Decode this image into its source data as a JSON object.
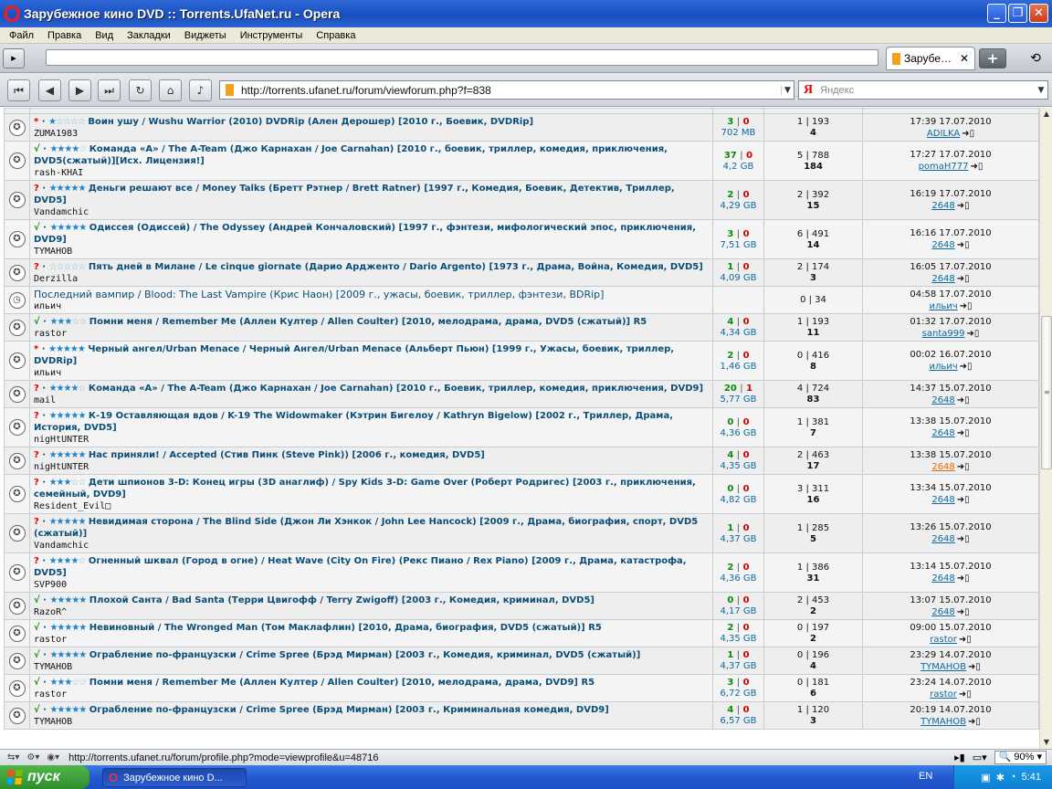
{
  "window": {
    "title": "Зарубежное кино DVD :: Torrents.UfaNet.ru - Opera",
    "controls": [
      "_",
      "❐",
      "✕"
    ]
  },
  "menu": [
    "Файл",
    "Правка",
    "Вид",
    "Закладки",
    "Виджеты",
    "Инструменты",
    "Справка"
  ],
  "tab": {
    "label": "Зарубе…",
    "close": "✕",
    "add": "+"
  },
  "address": {
    "url": "http://torrents.ufanet.ru/forum/viewforum.php?f=838"
  },
  "search": {
    "placeholder": "Яндекс",
    "engine": "Я"
  },
  "colors": {
    "ok_status": "#0a8a0a",
    "question_status": "#dd0000",
    "link": "#0b6aa0"
  },
  "topics": [
    {
      "status": "*",
      "status_type": "star",
      "rating": 1,
      "title": "Воин ушу / Wushu Warrior (2010) DVDRip (Ален Дерошер) [2010 г., Боевик, DVDRip]",
      "author": "ZUMA1983",
      "seeds": "3",
      "leech": "0",
      "size": "702 MB",
      "replies": "1 | 193",
      "downloads": "4",
      "last_time": "17:39 17.07.2010",
      "last_user": "ADILKA"
    },
    {
      "status": "√",
      "status_type": "ok",
      "rating": 4,
      "title": "Команда «А» / The A-Team (Джо Карнахан / Joe Carnahan) [2010 г., боевик, триллер, комедия, приключения, DVD5(сжатый)][Исх. Лицензия!]",
      "author": "rash-KHAI",
      "seeds": "37",
      "leech": "0",
      "size": "4,2 GB",
      "replies": "5 | 788",
      "downloads": "184",
      "last_time": "17:27 17.07.2010",
      "last_user": "pomaH777"
    },
    {
      "status": "?",
      "status_type": "q",
      "rating": 5,
      "title": "Деньги решают все / Money Talks (Бретт Рэтнер / Brett Ratner) [1997 г., Комедия, Боевик, Детектив, Триллер, DVD5]",
      "author": "Vandamchic",
      "seeds": "2",
      "leech": "0",
      "size": "4,29 GB",
      "replies": "2 | 392",
      "downloads": "15",
      "last_time": "16:19 17.07.2010",
      "last_user": "2648"
    },
    {
      "status": "√",
      "status_type": "ok",
      "rating": 5,
      "title": "Одиссея (Одиссей) / The Odyssey (Андрей Кончаловский) [1997 г., фэнтези, мифологический эпос, приключения, DVD9]",
      "author": "TYMAHOB",
      "seeds": "3",
      "leech": "0",
      "size": "7,51 GB",
      "replies": "6 | 491",
      "downloads": "14",
      "last_time": "16:16 17.07.2010",
      "last_user": "2648"
    },
    {
      "status": "?",
      "status_type": "q",
      "rating": 0,
      "title": "Пять дней в Милане / Le cinque giornate (Дарио Ардженто / Dario Argento) [1973 г., Драма, Война, Комедия, DVD5]",
      "author": "Derzilla",
      "seeds": "1",
      "leech": "0",
      "size": "4,09 GB",
      "replies": "2 | 174",
      "downloads": "3",
      "last_time": "16:05 17.07.2010",
      "last_user": "2648"
    },
    {
      "status": "",
      "status_type": "plain",
      "rating": -1,
      "title": "Последний вампир / Blood: The Last Vampire (Крис Наон) [2009 г., ужасы, боевик, триллер, фэнтези, BDRip]",
      "author": "ильич",
      "seeds": "",
      "leech": "",
      "size": "",
      "replies": "0 | 34",
      "downloads": "",
      "last_time": "04:58 17.07.2010",
      "last_user": "ильич"
    },
    {
      "status": "√",
      "status_type": "ok",
      "rating": 3,
      "title": "Помни меня / Remember Me (Аллен Култер / Allen Coulter) [2010, мелодрама, драма, DVD5 (сжатый)] R5",
      "author": "rastor",
      "seeds": "4",
      "leech": "0",
      "size": "4,34 GB",
      "replies": "1 | 193",
      "downloads": "11",
      "last_time": "01:32 17.07.2010",
      "last_user": "santa999"
    },
    {
      "status": "*",
      "status_type": "star",
      "rating": 5,
      "title": "Черный ангел/Urban Menace / Черный Ангел/Urban Menace (Альберт Пьюн) [1999 г., Ужасы, боевик, триллер, DVDRip]",
      "author": "ильич",
      "seeds": "2",
      "leech": "0",
      "size": "1,46 GB",
      "replies": "0 | 416",
      "downloads": "8",
      "last_time": "00:02 16.07.2010",
      "last_user": "ильич"
    },
    {
      "status": "?",
      "status_type": "q",
      "rating": 4,
      "title": "Команда «А» / The A-Team (Джо Карнахан / Joe Carnahan) [2010 г., Боевик, триллер, комедия, приключения, DVD9]",
      "author": "mail",
      "seeds": "20",
      "leech": "1",
      "size": "5,77 GB",
      "replies": "4 | 724",
      "downloads": "83",
      "last_time": "14:37 15.07.2010",
      "last_user": "2648"
    },
    {
      "status": "?",
      "status_type": "q",
      "rating": 5,
      "title": "К-19 Оставляющая вдов / K-19 The Widowmaker (Кэтрин Бигелоу / Kathryn Bigelow) [2002 г., Триллер, Драма, История, DVD5]",
      "author": "nigHtUNTER",
      "seeds": "0",
      "leech": "0",
      "size": "4,36 GB",
      "replies": "1 | 381",
      "downloads": "7",
      "last_time": "13:38 15.07.2010",
      "last_user": "2648"
    },
    {
      "status": "?",
      "status_type": "q",
      "rating": 5,
      "title": "Нас приняли! / Accepted (Стив Пинк (Steve Pink)) [2006 г., комедия, DVD5]",
      "author": "nigHtUNTER",
      "seeds": "4",
      "leech": "0",
      "size": "4,35 GB",
      "replies": "2 | 463",
      "downloads": "17",
      "last_time": "13:38 15.07.2010",
      "last_user": "2648",
      "last_user_alt": true
    },
    {
      "status": "?",
      "status_type": "q",
      "rating": 3,
      "title": "Дети шпионов 3-D: Конец игры (3D анаглиф) / Spy Kids 3-D: Game Over (Роберт Родригес) [2003 г., приключения, семейный, DVD9]",
      "author": "Resident_Evil□",
      "seeds": "0",
      "leech": "0",
      "size": "4,82 GB",
      "replies": "3 | 311",
      "downloads": "16",
      "last_time": "13:34 15.07.2010",
      "last_user": "2648"
    },
    {
      "status": "?",
      "status_type": "q",
      "rating": 5,
      "title": "Невидимая сторона / The Blind Side (Джон Ли Хэнкок / John Lee Hancock) [2009 г., Драма, биография, спорт, DVD5 (сжатый)]",
      "author": "Vandamchic",
      "seeds": "1",
      "leech": "0",
      "size": "4,37 GB",
      "replies": "1 | 285",
      "downloads": "5",
      "last_time": "13:26 15.07.2010",
      "last_user": "2648"
    },
    {
      "status": "?",
      "status_type": "q",
      "rating": 4,
      "title": "Огненный шквал (Город в огне) / Heat Wave (City On Fire) (Рекс Пиано / Rex Piano) [2009 г., Драма, катастрофа, DVD5]",
      "author": "SVP900",
      "seeds": "2",
      "leech": "0",
      "size": "4,36 GB",
      "replies": "1 | 386",
      "downloads": "31",
      "last_time": "13:14 15.07.2010",
      "last_user": "2648"
    },
    {
      "status": "√",
      "status_type": "ok",
      "rating": 5,
      "title": "Плохой Санта / Bad Santa (Терри Цвигофф / Terry Zwigoff) [2003 г., Комедия, криминал, DVD5]",
      "author": "RazoR^",
      "seeds": "0",
      "leech": "0",
      "size": "4,17 GB",
      "replies": "2 | 453",
      "downloads": "2",
      "last_time": "13:07 15.07.2010",
      "last_user": "2648"
    },
    {
      "status": "√",
      "status_type": "ok",
      "rating": 5,
      "title": "Невиновный / The Wronged Man (Том Маклафлин) [2010, Драма, биография, DVD5 (сжатый)] R5",
      "author": "rastor",
      "seeds": "2",
      "leech": "0",
      "size": "4,35 GB",
      "replies": "0 | 197",
      "downloads": "2",
      "last_time": "09:00 15.07.2010",
      "last_user": "rastor"
    },
    {
      "status": "√",
      "status_type": "ok",
      "rating": 5,
      "title": "Ограбление по-французски / Crime Spree (Брэд Мирман) [2003 г., Комедия, криминал, DVD5 (сжатый)]",
      "author": "TYMAHOB",
      "seeds": "1",
      "leech": "0",
      "size": "4,37 GB",
      "replies": "0 | 196",
      "downloads": "4",
      "last_time": "23:29 14.07.2010",
      "last_user": "TYMAHOB"
    },
    {
      "status": "√",
      "status_type": "ok",
      "rating": 3,
      "title": "Помни меня / Remember Me (Аллен Култер / Allen Coulter) [2010, мелодрама, драма, DVD9] R5",
      "author": "rastor",
      "seeds": "3",
      "leech": "0",
      "size": "6,72 GB",
      "replies": "0 | 181",
      "downloads": "6",
      "last_time": "23:24 14.07.2010",
      "last_user": "rastor"
    },
    {
      "status": "√",
      "status_type": "ok",
      "rating": 5,
      "title": "Ограбление по-французски / Crime Spree (Брэд Мирман) [2003 г., Криминальная комедия, DVD9]",
      "author": "TYMAHOB",
      "seeds": "4",
      "leech": "0",
      "size": "6,57 GB",
      "replies": "1 | 120",
      "downloads": "3",
      "last_time": "20:19 14.07.2010",
      "last_user": "TYMAHOB"
    }
  ],
  "statusbar": {
    "url": "http://torrents.ufanet.ru/forum/profile.php?mode=viewprofile&u=48716",
    "zoom": "90%"
  },
  "taskbar": {
    "start": "пуск",
    "task": "Зарубежное кино D...",
    "lang": "EN",
    "clock": "5:41"
  }
}
